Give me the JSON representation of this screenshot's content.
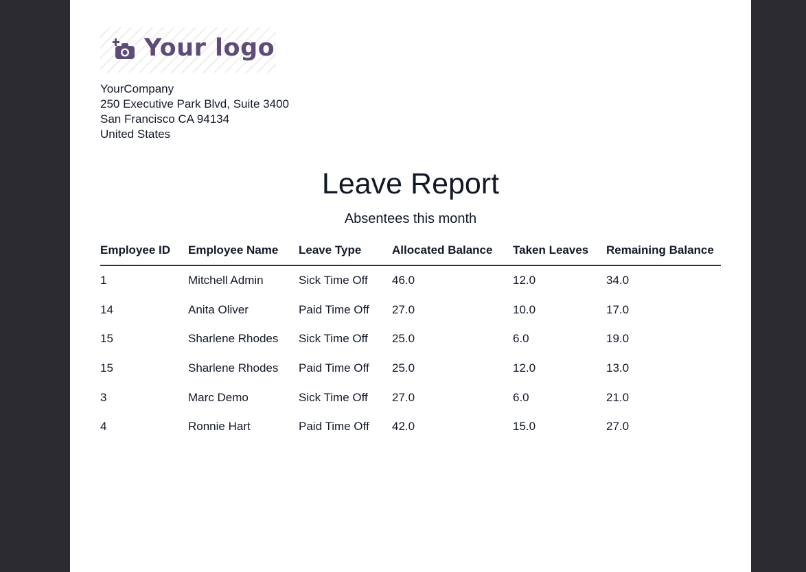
{
  "logo": {
    "text": "Your logo",
    "icon": "camera-plus-icon",
    "color": "#5f4b78"
  },
  "company": {
    "name": "YourCompany",
    "street": "250 Executive Park Blvd, Suite 3400",
    "city_line": "San Francisco CA 94134",
    "country": "United States"
  },
  "report": {
    "title": "Leave Report",
    "subtitle": "Absentees this month",
    "columns": [
      "Employee ID",
      "Employee Name",
      "Leave Type",
      "Allocated Balance",
      "Taken Leaves",
      "Remaining Balance"
    ],
    "rows": [
      [
        "1",
        "Mitchell Admin",
        "Sick Time Off",
        "46.0",
        "12.0",
        "34.0"
      ],
      [
        "14",
        "Anita Oliver",
        "Paid Time Off",
        "27.0",
        "10.0",
        "17.0"
      ],
      [
        "15",
        "Sharlene Rhodes",
        "Sick Time Off",
        "25.0",
        "6.0",
        "19.0"
      ],
      [
        "15",
        "Sharlene Rhodes",
        "Paid Time Off",
        "25.0",
        "12.0",
        "13.0"
      ],
      [
        "3",
        "Marc Demo",
        "Sick Time Off",
        "27.0",
        "6.0",
        "21.0"
      ],
      [
        "4",
        "Ronnie Hart",
        "Paid Time Off",
        "42.0",
        "15.0",
        "27.0"
      ]
    ]
  },
  "colors": {
    "viewer_background": "#2b2b30",
    "page": "#ffffff",
    "text": "#111827"
  }
}
